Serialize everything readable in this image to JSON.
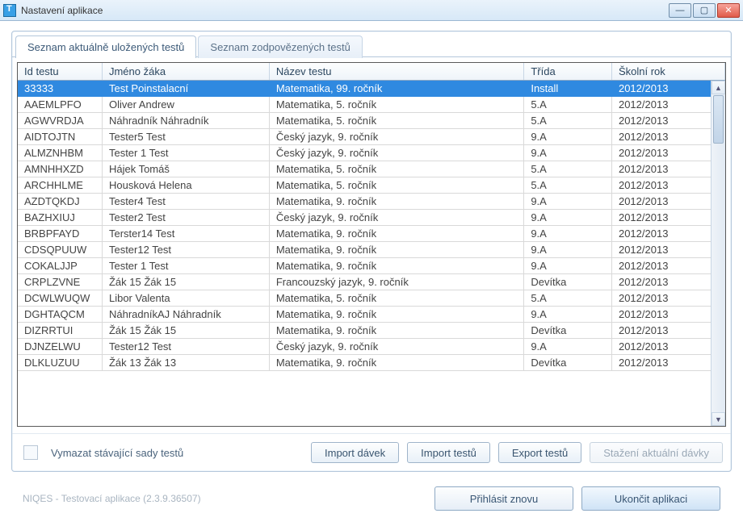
{
  "window": {
    "title": "Nastavení aplikace"
  },
  "tabs": {
    "list_saved": "Seznam aktuálně uložených testů",
    "list_answered": "Seznam zodpovězených testů"
  },
  "grid": {
    "headers": {
      "id": "Id testu",
      "student": "Jméno žáka",
      "test": "Název testu",
      "class": "Třída",
      "year": "Školní rok"
    },
    "rows": [
      {
        "id": "33333",
        "student": "Test Poinstalacní",
        "test": "Matematika, 99. ročník",
        "class": "Install",
        "year": "2012/2013",
        "selected": true
      },
      {
        "id": "AAEMLPFO",
        "student": "Oliver Andrew",
        "test": "Matematika, 5. ročník",
        "class": "5.A",
        "year": "2012/2013"
      },
      {
        "id": "AGWVRDJA",
        "student": "Náhradník Náhradník",
        "test": "Matematika, 5. ročník",
        "class": "5.A",
        "year": "2012/2013"
      },
      {
        "id": "AIDTOJTN",
        "student": "Tester5 Test",
        "test": "Český jazyk, 9. ročník",
        "class": "9.A",
        "year": "2012/2013"
      },
      {
        "id": "ALMZNHBM",
        "student": "Tester 1 Test",
        "test": "Český jazyk, 9. ročník",
        "class": "9.A",
        "year": "2012/2013"
      },
      {
        "id": "AMNHHXZD",
        "student": "Hájek Tomáš",
        "test": "Matematika, 5. ročník",
        "class": "5.A",
        "year": "2012/2013"
      },
      {
        "id": "ARCHHLME",
        "student": "Housková Helena",
        "test": "Matematika, 5. ročník",
        "class": "5.A",
        "year": "2012/2013"
      },
      {
        "id": "AZDTQKDJ",
        "student": "Tester4 Test",
        "test": "Matematika, 9. ročník",
        "class": "9.A",
        "year": "2012/2013"
      },
      {
        "id": "BAZHXIUJ",
        "student": "Tester2 Test",
        "test": "Český jazyk, 9. ročník",
        "class": "9.A",
        "year": "2012/2013"
      },
      {
        "id": "BRBPFAYD",
        "student": "Terster14 Test",
        "test": "Matematika, 9. ročník",
        "class": "9.A",
        "year": "2012/2013"
      },
      {
        "id": "CDSQPUUW",
        "student": "Tester12 Test",
        "test": "Matematika, 9. ročník",
        "class": "9.A",
        "year": "2012/2013"
      },
      {
        "id": "COKALJJP",
        "student": "Tester 1 Test",
        "test": "Matematika, 9. ročník",
        "class": "9.A",
        "year": "2012/2013"
      },
      {
        "id": "CRPLZVNE",
        "student": "Žák 15 Žák 15",
        "test": "Francouzský jazyk, 9. ročník",
        "class": "Devítka",
        "year": "2012/2013"
      },
      {
        "id": "DCWLWUQW",
        "student": "Libor Valenta",
        "test": "Matematika, 5. ročník",
        "class": "5.A",
        "year": "2012/2013"
      },
      {
        "id": "DGHTAQCM",
        "student": "NáhradníkAJ Náhradník",
        "test": "Matematika, 9. ročník",
        "class": "9.A",
        "year": "2012/2013"
      },
      {
        "id": "DIZRRTUI",
        "student": "Žák 15 Žák 15",
        "test": "Matematika, 9. ročník",
        "class": "Devítka",
        "year": "2012/2013"
      },
      {
        "id": "DJNZELWU",
        "student": "Tester12 Test",
        "test": "Český jazyk, 9. ročník",
        "class": "9.A",
        "year": "2012/2013"
      },
      {
        "id": "DLKLUZUU",
        "student": "Žák 13 Žák 13",
        "test": "Matematika, 9. ročník",
        "class": "Devítka",
        "year": "2012/2013"
      }
    ]
  },
  "footer": {
    "checkbox_label": "Vymazat stávající sady testů",
    "import_batch": "Import dávek",
    "import_tests": "Import testů",
    "export_tests": "Export testů",
    "download_batch": "Stažení aktuální dávky"
  },
  "appbar": {
    "info": "NIQES - Testovací aplikace (2.3.9.36507)",
    "relogin": "Přihlásit znovu",
    "quit": "Ukončit aplikaci"
  }
}
